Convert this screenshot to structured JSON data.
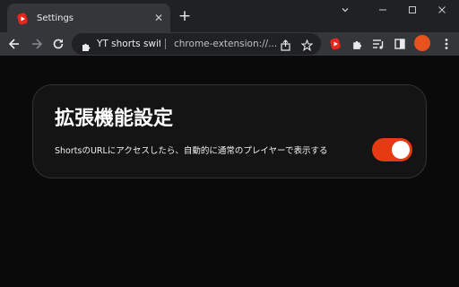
{
  "tab": {
    "title": "Settings",
    "favicon": "extension-red-play-icon"
  },
  "window_controls": [
    "chevron-down-icon",
    "minimize-icon",
    "maximize-icon",
    "close-icon"
  ],
  "toolbar": {
    "omnibox": {
      "extension_name": "YT shorts switch",
      "url": "chrome-extension://..."
    },
    "avatar_label": "avatar"
  },
  "settings": {
    "title": "拡張機能設定",
    "options": [
      {
        "label": "ShortsのURLにアクセスしたら、自動的に通常のプレイヤーで表示する",
        "enabled": true
      }
    ]
  },
  "colors": {
    "accent": "#e63b12",
    "card": "#141414",
    "background": "#0a0a0a"
  }
}
